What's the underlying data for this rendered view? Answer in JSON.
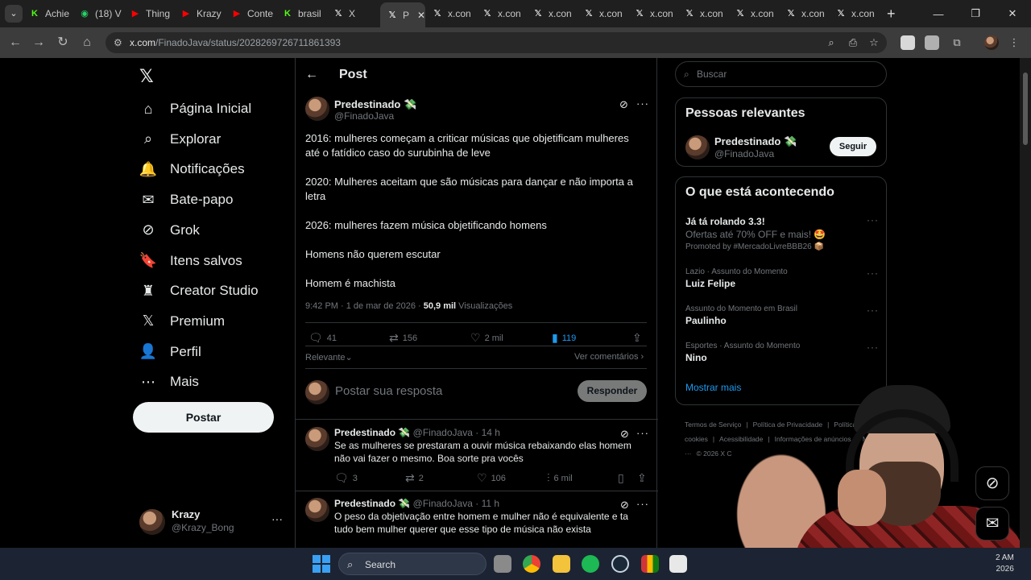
{
  "browser": {
    "tabs": [
      {
        "label": "Achie",
        "icon": "kick-icon",
        "color": "#53fc18"
      },
      {
        "label": "(18) V",
        "icon": "whatsapp-icon",
        "color": "#25d366"
      },
      {
        "label": "Thing",
        "icon": "youtube-icon",
        "color": "#ff0000"
      },
      {
        "label": "Krazy",
        "icon": "youtube-icon",
        "color": "#ff0000"
      },
      {
        "label": "Conte",
        "icon": "youtube-icon",
        "color": "#ff0000"
      },
      {
        "label": "brasil",
        "icon": "kick-icon",
        "color": "#53fc18"
      },
      {
        "label": "X",
        "icon": "x-icon",
        "color": "#ffffff"
      },
      {
        "label": "P",
        "icon": "x-icon",
        "color": "#ffffff",
        "active": true
      },
      {
        "label": "x.con",
        "icon": "x-icon",
        "color": "#ffffff"
      },
      {
        "label": "x.con",
        "icon": "x-icon",
        "color": "#ffffff"
      },
      {
        "label": "x.con",
        "icon": "x-icon",
        "color": "#ffffff"
      },
      {
        "label": "x.con",
        "icon": "x-icon",
        "color": "#ffffff"
      },
      {
        "label": "x.con",
        "icon": "x-icon",
        "color": "#ffffff"
      },
      {
        "label": "x.con",
        "icon": "x-icon",
        "color": "#ffffff"
      },
      {
        "label": "x.con",
        "icon": "x-icon",
        "color": "#ffffff"
      },
      {
        "label": "x.con",
        "icon": "x-icon",
        "color": "#ffffff"
      },
      {
        "label": "x.con",
        "icon": "x-icon",
        "color": "#ffffff"
      }
    ],
    "url_host": "x.com",
    "url_path": "/FinadoJava/status/2028269726711861393"
  },
  "nav": {
    "items": [
      {
        "label": "Página Inicial",
        "icon": "home-icon",
        "glyph": "⌂"
      },
      {
        "label": "Explorar",
        "icon": "search-icon",
        "glyph": "⌕"
      },
      {
        "label": "Notificações",
        "icon": "bell-icon",
        "glyph": "🔔"
      },
      {
        "label": "Bate-papo",
        "icon": "mail-icon",
        "glyph": "✉"
      },
      {
        "label": "Grok",
        "icon": "grok-icon",
        "glyph": "⊘"
      },
      {
        "label": "Itens salvos",
        "icon": "bookmark-icon",
        "glyph": "🔖"
      },
      {
        "label": "Creator Studio",
        "icon": "creator-icon",
        "glyph": "♜"
      },
      {
        "label": "Premium",
        "icon": "x-premium-icon",
        "glyph": "𝕏"
      },
      {
        "label": "Perfil",
        "icon": "person-icon",
        "glyph": "👤"
      },
      {
        "label": "Mais",
        "icon": "more-circle-icon",
        "glyph": "⋯"
      }
    ],
    "post_button": "Postar",
    "account": {
      "name": "Krazy",
      "handle": "@Krazy_Bong"
    }
  },
  "post": {
    "header_title": "Post",
    "author_name": "Predestinado 💸",
    "author_handle": "@FinadoJava",
    "paragraphs": [
      "2016: mulheres começam a criticar músicas que objetificam mulheres até o fatídico caso do surubinha de leve",
      "2020: Mulheres aceitam que são músicas para dançar e não importa a letra",
      "2026: mulheres fazem música objetificando homens",
      "Homens não querem escutar",
      "Homem é machista"
    ],
    "time": "9:42 PM · 1 de mar de 2026 · ",
    "views_count": "50,9 mil",
    "views_label": "Visualizações",
    "stats": {
      "replies": "41",
      "reposts": "156",
      "likes": "2 mil",
      "bookmarks": "119"
    },
    "sort_label": "Relevante",
    "view_comments": "Ver comentários",
    "reply_placeholder": "Postar sua resposta",
    "reply_button": "Responder"
  },
  "replies": [
    {
      "name": "Predestinado 💸",
      "handle": "@FinadoJava",
      "time": "14 h",
      "text": "Se as mulheres se prestaram a ouvir música rebaixando elas homem não vai fazer o mesmo. Boa sorte pra vocês",
      "stats": {
        "replies": "3",
        "reposts": "2",
        "likes": "106",
        "views": "6 mil"
      }
    },
    {
      "name": "Predestinado 💸",
      "handle": "@FinadoJava",
      "time": "11 h",
      "text": "O peso da objetivação entre homem e mulher não é equivalente e ta tudo bem mulher querer que esse tipo de música não exista"
    }
  ],
  "sidebar": {
    "search_placeholder": "Buscar",
    "relevant_title": "Pessoas relevantes",
    "relevant_person": {
      "name": "Predestinado 💸",
      "handle": "@FinadoJava",
      "button": "Seguir"
    },
    "trending_title": "O que está acontecendo",
    "trends": [
      {
        "meta": "",
        "title": "Já tá rolando 3.3!",
        "sub": "Ofertas até 70% OFF e mais! 🤩",
        "promo": "Promoted by #MercadoLivreBBB26 📦"
      },
      {
        "meta": "Lazio · Assunto do Momento",
        "title": "Luiz Felipe"
      },
      {
        "meta": "Assunto do Momento em Brasil",
        "title": "Paulinho"
      },
      {
        "meta": "Esportes · Assunto do Momento",
        "title": "Nino"
      }
    ],
    "show_more": "Mostrar mais",
    "footer": [
      "Termos de Serviço",
      "|",
      "Política de Privacidade",
      "|",
      "Política de cookies",
      "|",
      "Acessibilidade",
      "|",
      "Informações de anúncios",
      "|",
      "Mais ···",
      "© 2026 X C"
    ]
  },
  "taskbar": {
    "search_label": "Search",
    "clock_time": "2 AM",
    "clock_date": "2026"
  }
}
